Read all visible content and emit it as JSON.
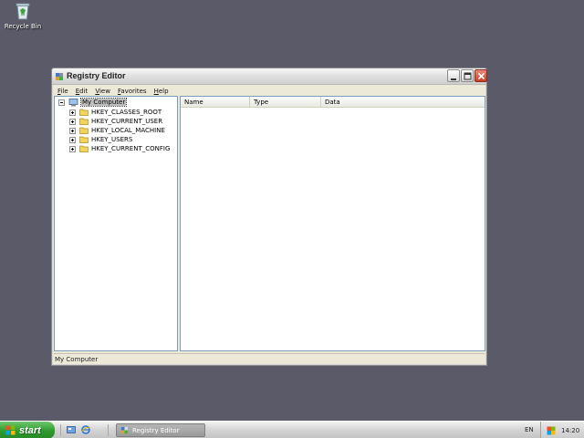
{
  "desktop": {
    "recycle_bin_label": "Recycle Bin"
  },
  "window": {
    "title": "Registry Editor",
    "menu": [
      {
        "label": "File",
        "accel": "F",
        "rest": "ile"
      },
      {
        "label": "Edit",
        "accel": "E",
        "rest": "dit"
      },
      {
        "label": "View",
        "accel": "V",
        "rest": "iew"
      },
      {
        "label": "Favorites",
        "accel": "F",
        "rest": "avorites"
      },
      {
        "label": "Help",
        "accel": "H",
        "rest": "elp"
      }
    ],
    "tree": {
      "root": "My Computer",
      "children": [
        "HKEY_CLASSES_ROOT",
        "HKEY_CURRENT_USER",
        "HKEY_LOCAL_MACHINE",
        "HKEY_USERS",
        "HKEY_CURRENT_CONFIG"
      ]
    },
    "columns": {
      "name": "Name",
      "type": "Type",
      "data": "Data"
    },
    "status_text": "My Computer"
  },
  "taskbar": {
    "start_label": "start",
    "task_button_label": "Registry Editor",
    "language": "EN",
    "clock": "14:20"
  },
  "colors": {
    "desktop": "#5a5a68",
    "start_green": "#2e9a2e",
    "close_red": "#c8402a",
    "folder_yellow": "#f2d35c"
  }
}
